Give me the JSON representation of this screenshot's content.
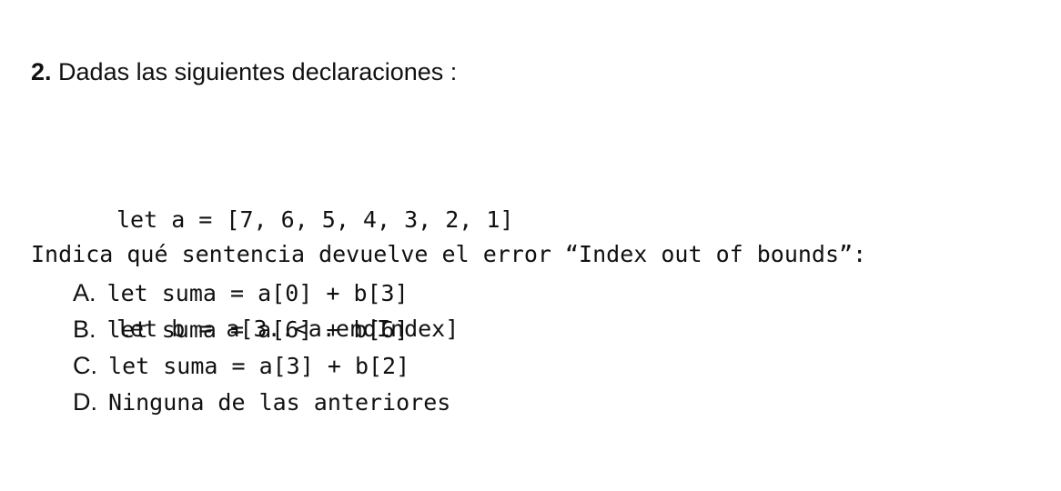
{
  "question": {
    "number": "2.",
    "text": " Dadas las siguientes declaraciones :"
  },
  "code": {
    "lines": [
      "let a = [7, 6, 5, 4, 3, 2, 1]",
      "let b = a[3..<a.endIndex]"
    ]
  },
  "prompt": "Indica qué sentencia devuelve el error “Index out of bounds”:",
  "options": [
    {
      "letter": "A",
      "sep": ".",
      "text": "let suma = a[0] + b[3]"
    },
    {
      "letter": "B",
      "sep": ".",
      "text": "let suma = a[6] + b[6]"
    },
    {
      "letter": "C",
      "sep": ".",
      "text": "let suma = a[3] + b[2]"
    },
    {
      "letter": "D",
      "sep": ".",
      "text": "Ninguna de las anteriores"
    }
  ]
}
